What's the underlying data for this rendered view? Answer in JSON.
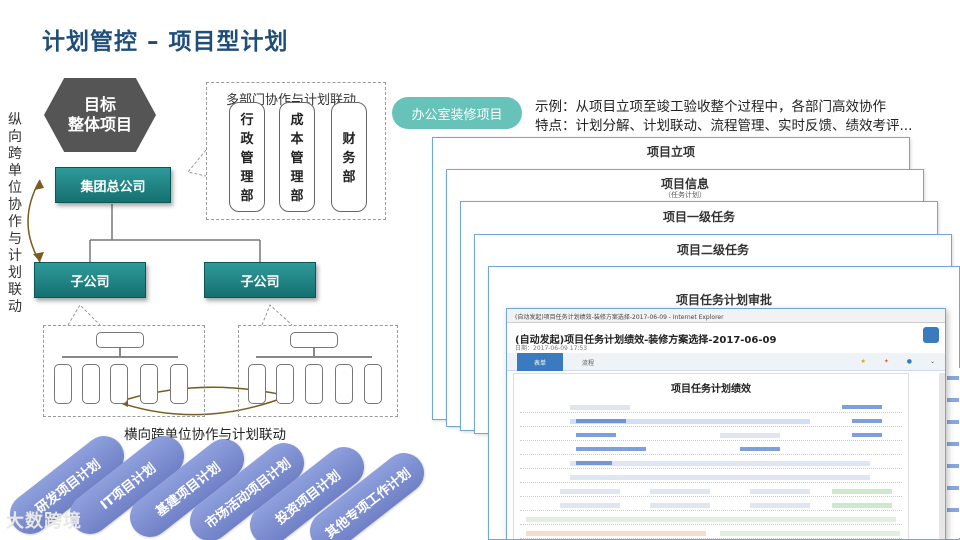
{
  "title": "计划管控 – 项目型计划",
  "left_panel": {
    "vertical_label": "纵向跨单位协作与计划联动",
    "hexagon_line1": "目标",
    "hexagon_line2": "整体项目",
    "group_hq": "集团总公司",
    "subsidiary_1": "子公司",
    "subsidiary_2": "子公司",
    "dept_caption": "多部门协作与计划联动",
    "departments": [
      "行政管理部",
      "成本管理部",
      "财务部"
    ],
    "horizontal_label": "横向跨单位协作与计划联动"
  },
  "plan_pills": [
    "研发项目计划",
    "IT项目计划",
    "基建项目计划",
    "市场活动项目计划",
    "投资项目计划",
    "其他专项工作计划"
  ],
  "logo_text": "大数跨境",
  "right_panel": {
    "tag": "办公室装修项目",
    "example": "示例：从项目立项至竣工验收整个过程中，各部门高效协作",
    "features": "特点：计划分解、计划联动、流程管理、实时反馈、绩效考评...",
    "layers": [
      {
        "title": "项目立项"
      },
      {
        "title": "项目信息",
        "sub": "（任务计划）"
      },
      {
        "title": "项目一级任务"
      },
      {
        "title": "项目二级任务"
      },
      {
        "title": "项目任务计划审批"
      }
    ],
    "window": {
      "browser_bar": "(自动发起)项目任务计划绩效-装修方案选择-2017-06-09 - Internet Explorer",
      "heading": "(自动发起)项目任务计划绩效-装修方案选择-2017-06-09",
      "date": "日期：2017-06-09 17:53",
      "tab_active": "表单",
      "tab_other": "流程",
      "form_title": "项目任务计划绩效"
    }
  },
  "colors": {
    "title": "#1f4e79",
    "teal": "#1a7a7a",
    "hexagon": "#555555",
    "pill": "#7b8bd0",
    "tag": "#67c3b9",
    "arrow": "#7a5c1e"
  }
}
